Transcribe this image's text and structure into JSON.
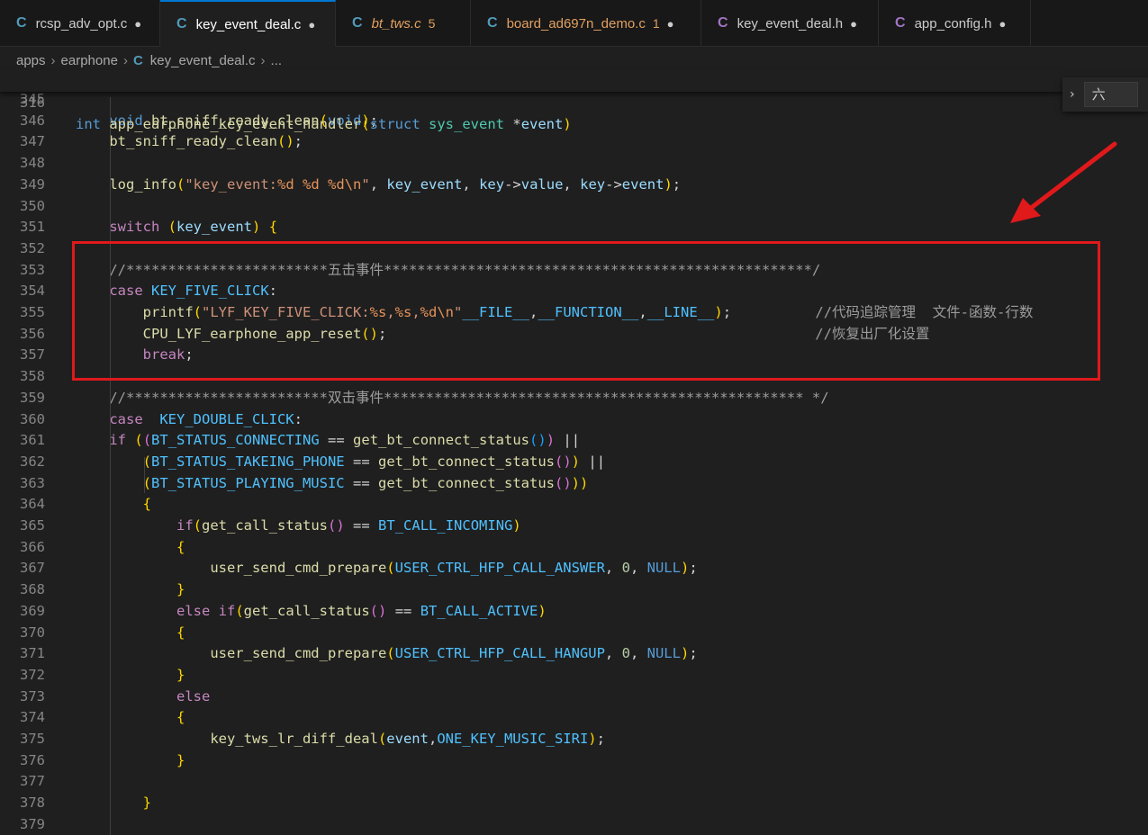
{
  "tabs": [
    {
      "icon": "C",
      "name": "rcsp_adv_opt.c",
      "badge": "",
      "dot": "●",
      "active": false,
      "color": "#cccccc",
      "icon_color": "#519aba",
      "italic": false
    },
    {
      "icon": "C",
      "name": "key_event_deal.c",
      "badge": "",
      "dot": "●",
      "active": true,
      "color": "#ffffff",
      "icon_color": "#519aba",
      "italic": false
    },
    {
      "icon": "C",
      "name": "bt_tws.c",
      "badge": "5",
      "dot": "",
      "active": false,
      "color": "#e2a060",
      "icon_color": "#519aba",
      "italic": true
    },
    {
      "icon": "C",
      "name": "board_ad697n_demo.c",
      "badge": "1",
      "dot": "●",
      "active": false,
      "color": "#e2a060",
      "icon_color": "#519aba",
      "italic": false
    },
    {
      "icon": "C",
      "name": "key_event_deal.h",
      "badge": "",
      "dot": "●",
      "active": false,
      "color": "#cccccc",
      "icon_color": "#a074c4",
      "italic": false
    },
    {
      "icon": "C",
      "name": "app_config.h",
      "badge": "",
      "dot": "●",
      "active": false,
      "color": "#cccccc",
      "icon_color": "#a074c4",
      "italic": false
    }
  ],
  "breadcrumb": {
    "p1": "apps",
    "p2": "earphone",
    "icon": "C",
    "file": "key_event_deal.c",
    "more": "...",
    "sep": "›"
  },
  "sticky": {
    "ln": "316",
    "text": "int app_earphone_key_event_handler(struct sys_event *event)"
  },
  "find": {
    "chevron": "›",
    "value": "六"
  },
  "lines": [
    {
      "ln": "345",
      "text": ""
    },
    {
      "ln": "346",
      "text": "    void bt_sniff_ready_clean(void);"
    },
    {
      "ln": "347",
      "text": "    bt_sniff_ready_clean();"
    },
    {
      "ln": "348",
      "text": ""
    },
    {
      "ln": "349",
      "text": "    log_info(\"key_event:%d %d %d\\n\", key_event, key->value, key->event);"
    },
    {
      "ln": "350",
      "text": ""
    },
    {
      "ln": "351",
      "text": "    switch (key_event) {"
    },
    {
      "ln": "352",
      "text": ""
    },
    {
      "ln": "353",
      "text": "    //************************五击事件***************************************************/"
    },
    {
      "ln": "354",
      "text": "    case KEY_FIVE_CLICK:"
    },
    {
      "ln": "355",
      "text": "        printf(\"LYF_KEY_FIVE_CLICK:%s,%s,%d\\n\"__FILE__,__FUNCTION__,__LINE__);          //代码追踪管理  文件-函数-行数"
    },
    {
      "ln": "356",
      "text": "        CPU_LYF_earphone_app_reset();                                                   //恢复出厂化设置"
    },
    {
      "ln": "357",
      "text": "        break;"
    },
    {
      "ln": "358",
      "text": ""
    },
    {
      "ln": "359",
      "text": "    //************************双击事件************************************************** */"
    },
    {
      "ln": "360",
      "text": "    case  KEY_DOUBLE_CLICK:"
    },
    {
      "ln": "361",
      "text": "    if ((BT_STATUS_CONNECTING == get_bt_connect_status()) ||"
    },
    {
      "ln": "362",
      "text": "        (BT_STATUS_TAKEING_PHONE == get_bt_connect_status()) ||"
    },
    {
      "ln": "363",
      "text": "        (BT_STATUS_PLAYING_MUSIC == get_bt_connect_status()))"
    },
    {
      "ln": "364",
      "text": "        {"
    },
    {
      "ln": "365",
      "text": "            if(get_call_status() == BT_CALL_INCOMING)"
    },
    {
      "ln": "366",
      "text": "            {"
    },
    {
      "ln": "367",
      "text": "                user_send_cmd_prepare(USER_CTRL_HFP_CALL_ANSWER, 0, NULL);"
    },
    {
      "ln": "368",
      "text": "            }"
    },
    {
      "ln": "369",
      "text": "            else if(get_call_status() == BT_CALL_ACTIVE)"
    },
    {
      "ln": "370",
      "text": "            {"
    },
    {
      "ln": "371",
      "text": "                user_send_cmd_prepare(USER_CTRL_HFP_CALL_HANGUP, 0, NULL);"
    },
    {
      "ln": "372",
      "text": "            }"
    },
    {
      "ln": "373",
      "text": "            else"
    },
    {
      "ln": "374",
      "text": "            {"
    },
    {
      "ln": "375",
      "text": "                key_tws_lr_diff_deal(event,ONE_KEY_MUSIC_SIRI);"
    },
    {
      "ln": "376",
      "text": "            }"
    },
    {
      "ln": "377",
      "text": ""
    },
    {
      "ln": "378",
      "text": "        }"
    },
    {
      "ln": "379",
      "text": ""
    }
  ],
  "colors": {
    "highlight": "#e0191b",
    "accent": "#0078d4",
    "background": "#1f1f1f"
  }
}
